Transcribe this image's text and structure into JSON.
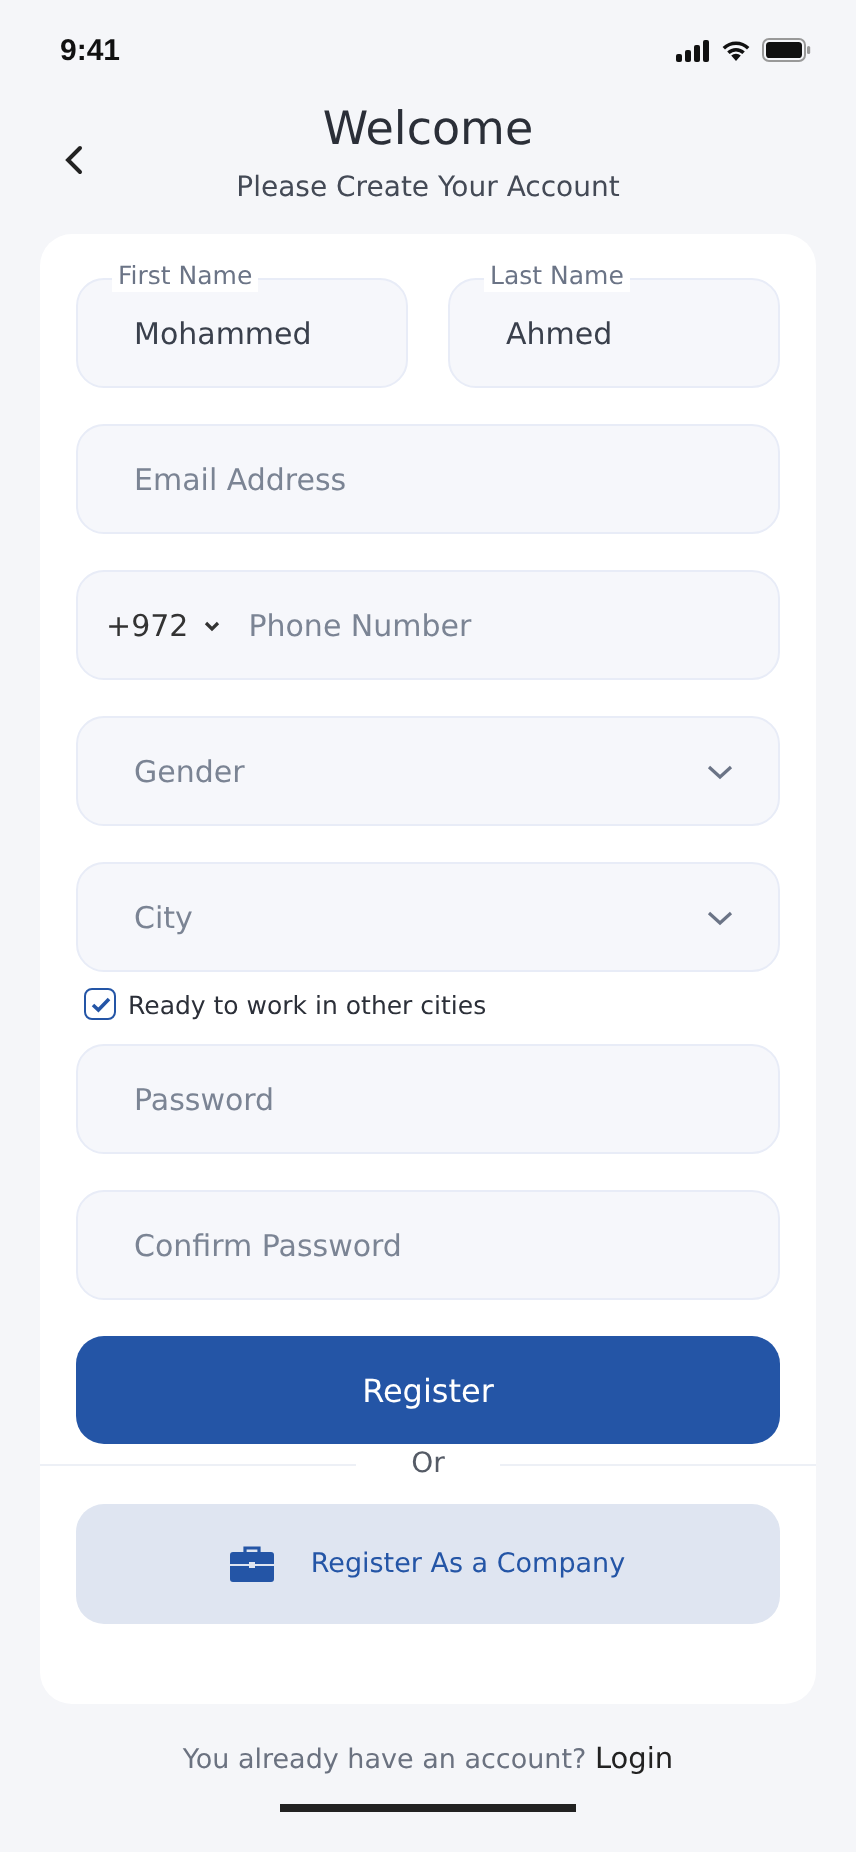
{
  "status_bar": {
    "time": "9:41"
  },
  "header": {
    "title": "Welcome",
    "subtitle": "Please Create Your Account"
  },
  "name_fields": [
    {
      "label": "First Name",
      "value": "Mohammed"
    },
    {
      "label": "Last Name",
      "value": "Ahmed"
    }
  ],
  "fields": [
    {
      "kind": "text",
      "placeholder": "Email Address"
    },
    {
      "kind": "phone",
      "code": "+972",
      "placeholder": "Phone Number"
    },
    {
      "kind": "select",
      "placeholder": "Gender"
    },
    {
      "kind": "select",
      "placeholder": "City"
    },
    {
      "kind": "checkbox",
      "label": "Ready to work in other cities",
      "checked": true
    },
    {
      "kind": "password",
      "placeholder": "Password"
    },
    {
      "kind": "password",
      "placeholder": "Confirm Password"
    }
  ],
  "register_button": "Register",
  "divider_text": "Or",
  "company_button": "Register As a Company",
  "footer": {
    "text": "You already have an account?",
    "link": "Login"
  }
}
